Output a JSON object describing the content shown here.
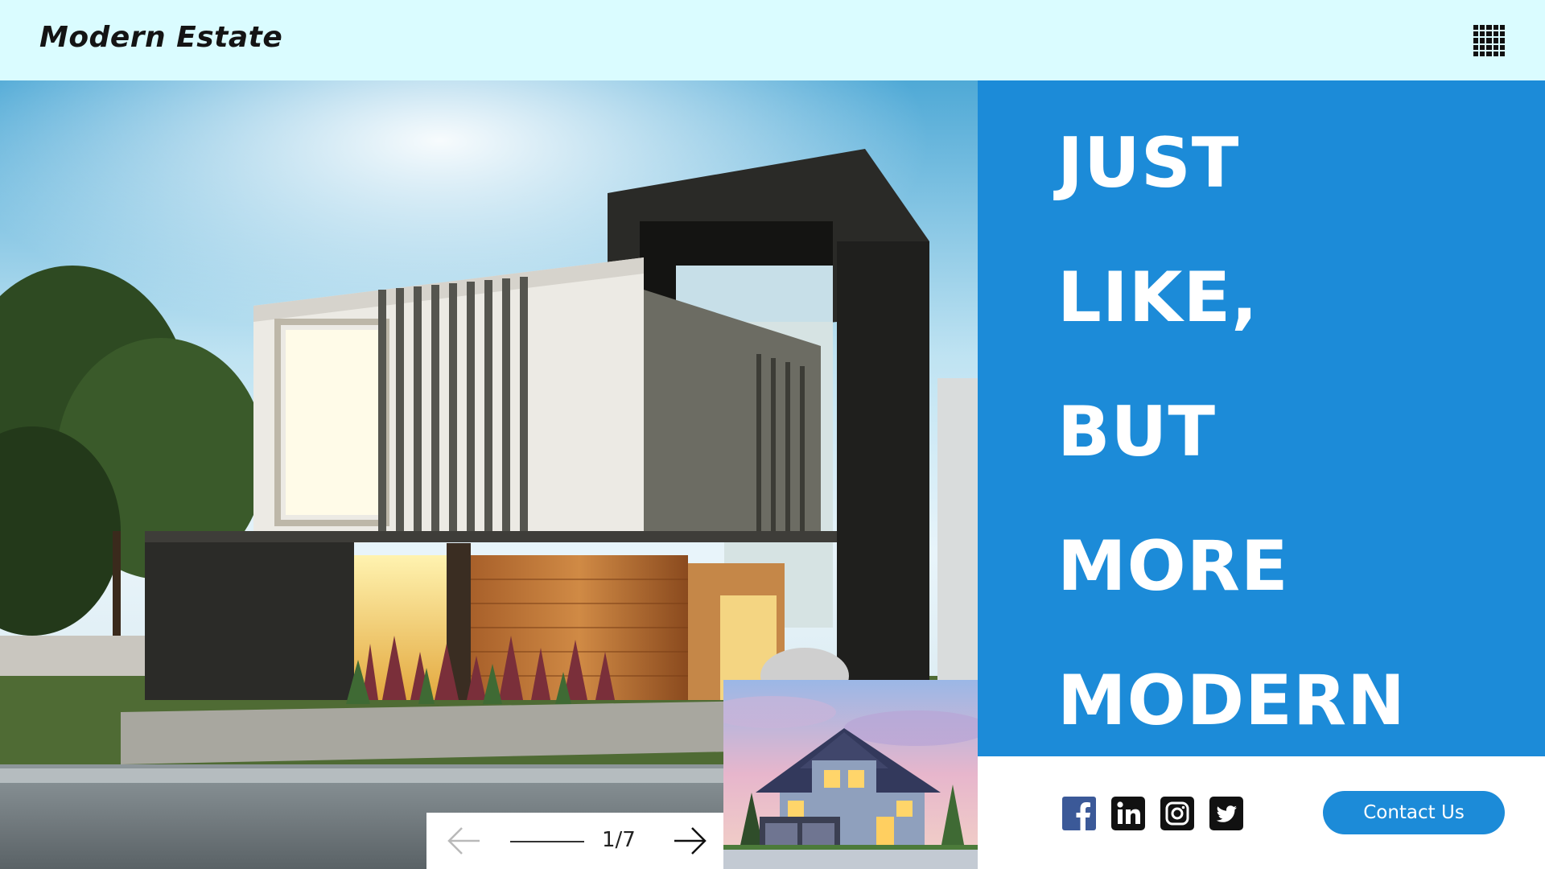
{
  "header": {
    "brand": "Modern Estate",
    "menu_icon": "grid-menu-icon"
  },
  "hero": {
    "headline_lines": [
      "JUST",
      "LIKE,",
      "BUT",
      "MORE",
      "MODERN"
    ]
  },
  "slider": {
    "prev_icon": "arrow-left-icon",
    "next_icon": "arrow-right-icon",
    "counter": "1/7"
  },
  "social": {
    "icons": [
      "facebook-icon",
      "linkedin-icon",
      "instagram-icon",
      "twitter-icon"
    ]
  },
  "cta": {
    "contact_label": "Contact Us"
  },
  "colors": {
    "header_bg": "#dafcff",
    "accent_blue": "#1c8bd8",
    "text_dark": "#141414",
    "white": "#ffffff",
    "facebook": "#3b5998"
  }
}
